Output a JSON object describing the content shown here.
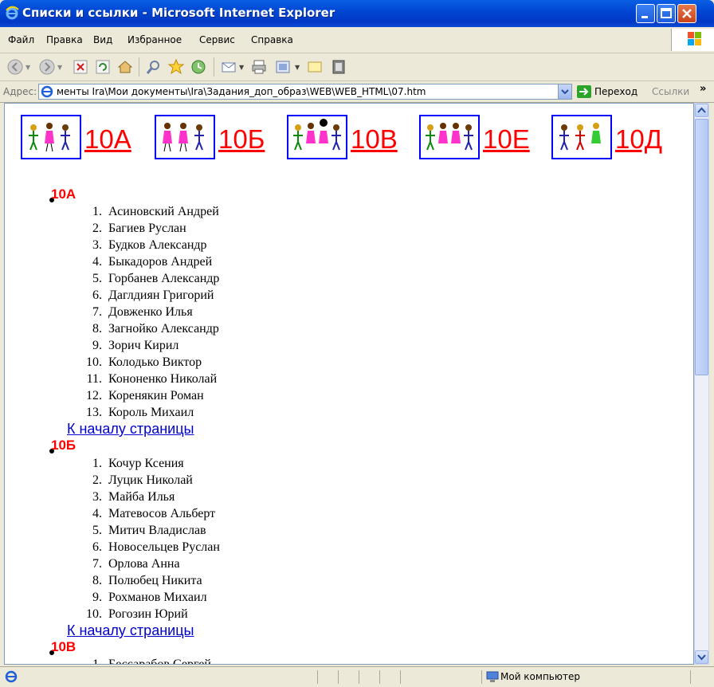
{
  "window": {
    "title": "Списки и ссылки - Microsoft Internet Explorer"
  },
  "menu": [
    "Файл",
    "Правка",
    "Вид",
    "Избранное",
    "Сервис",
    "Справка"
  ],
  "address": {
    "label": "Адрес:",
    "url": "менты Ira\\Мои документы\\Ira\\Задания_доп_образ\\WEB\\WEB_HTML\\07.htm",
    "go_label": "Переход",
    "links_label": "Ссылки"
  },
  "header_classes": [
    "10А",
    "10Б",
    "10В",
    "10Е",
    "10Д"
  ],
  "groups": [
    {
      "name": "10А",
      "students": [
        "Асиновский Андрей",
        "Багиев Руслан",
        "Будков Александр",
        "Быкадоров Андрей",
        "Горбанев Александр",
        "Даглдиян Григорий",
        "Довженко Илья",
        "Загнойко Александр",
        "Зорич Кирил",
        "Колодько Виктор",
        "Кононенко Николай",
        "Коренякин Роман",
        "Король Михаил"
      ],
      "back_label": "К началу страницы"
    },
    {
      "name": "10Б",
      "students": [
        "Кочур Ксения",
        "Луцик Николай",
        "Майба Илья",
        "Матевосов Альберт",
        "Митич Владислав",
        "Новосельцев Руслан",
        "Орлова Анна",
        "Полюбец Никита",
        "Рохманов Михаил",
        "Рогозин Юрий"
      ],
      "back_label": "К началу страницы"
    },
    {
      "name": "10В",
      "students": [
        "Бессарабов Сергей"
      ]
    }
  ],
  "status": {
    "zone": "Мой компьютер"
  }
}
